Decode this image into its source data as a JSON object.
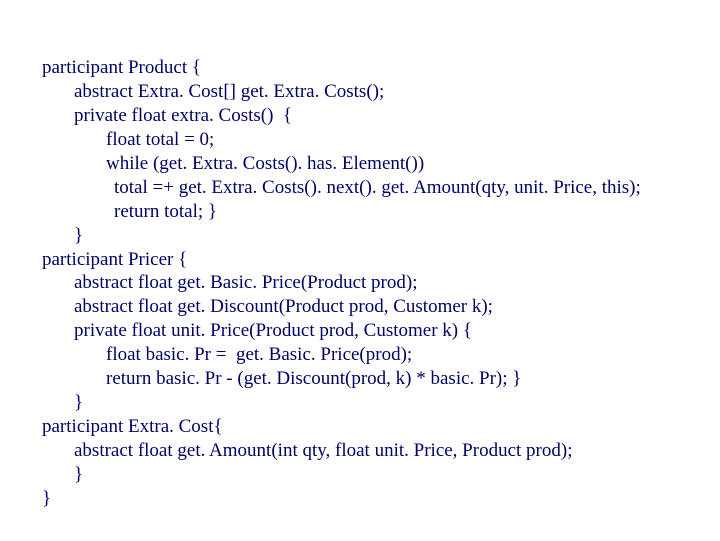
{
  "lines": [
    {
      "indent": "l0",
      "text": "participant Product {"
    },
    {
      "indent": "l1",
      "text": "abstract Extra. Cost[] get. Extra. Costs();"
    },
    {
      "indent": "l1",
      "text": "private float extra. Costs()  {"
    },
    {
      "indent": "l2",
      "text": "float total = 0;"
    },
    {
      "indent": "l2",
      "text": "while (get. Extra. Costs(). has. Element())"
    },
    {
      "indent": "l3",
      "text": "total =+ get. Extra. Costs(). next(). get. Amount(qty, unit. Price, this);"
    },
    {
      "indent": "l3",
      "text": "return total; }"
    },
    {
      "indent": "l1",
      "text": "}"
    },
    {
      "indent": "l0",
      "text": "participant Pricer {"
    },
    {
      "indent": "l1",
      "text": "abstract float get. Basic. Price(Product prod);"
    },
    {
      "indent": "l1",
      "text": "abstract float get. Discount(Product prod, Customer k);"
    },
    {
      "indent": "l1",
      "text": "private float unit. Price(Product prod, Customer k) {"
    },
    {
      "indent": "l2",
      "text": "float basic. Pr =  get. Basic. Price(prod);"
    },
    {
      "indent": "l2",
      "text": "return basic. Pr - (get. Discount(prod, k) * basic. Pr); }"
    },
    {
      "indent": "l1",
      "text": "}"
    },
    {
      "indent": "l0",
      "text": "participant Extra. Cost{"
    },
    {
      "indent": "l1",
      "text": "abstract float get. Amount(int qty, float unit. Price, Product prod);"
    },
    {
      "indent": "l1",
      "text": "}"
    },
    {
      "indent": "l0",
      "text": "}"
    }
  ]
}
